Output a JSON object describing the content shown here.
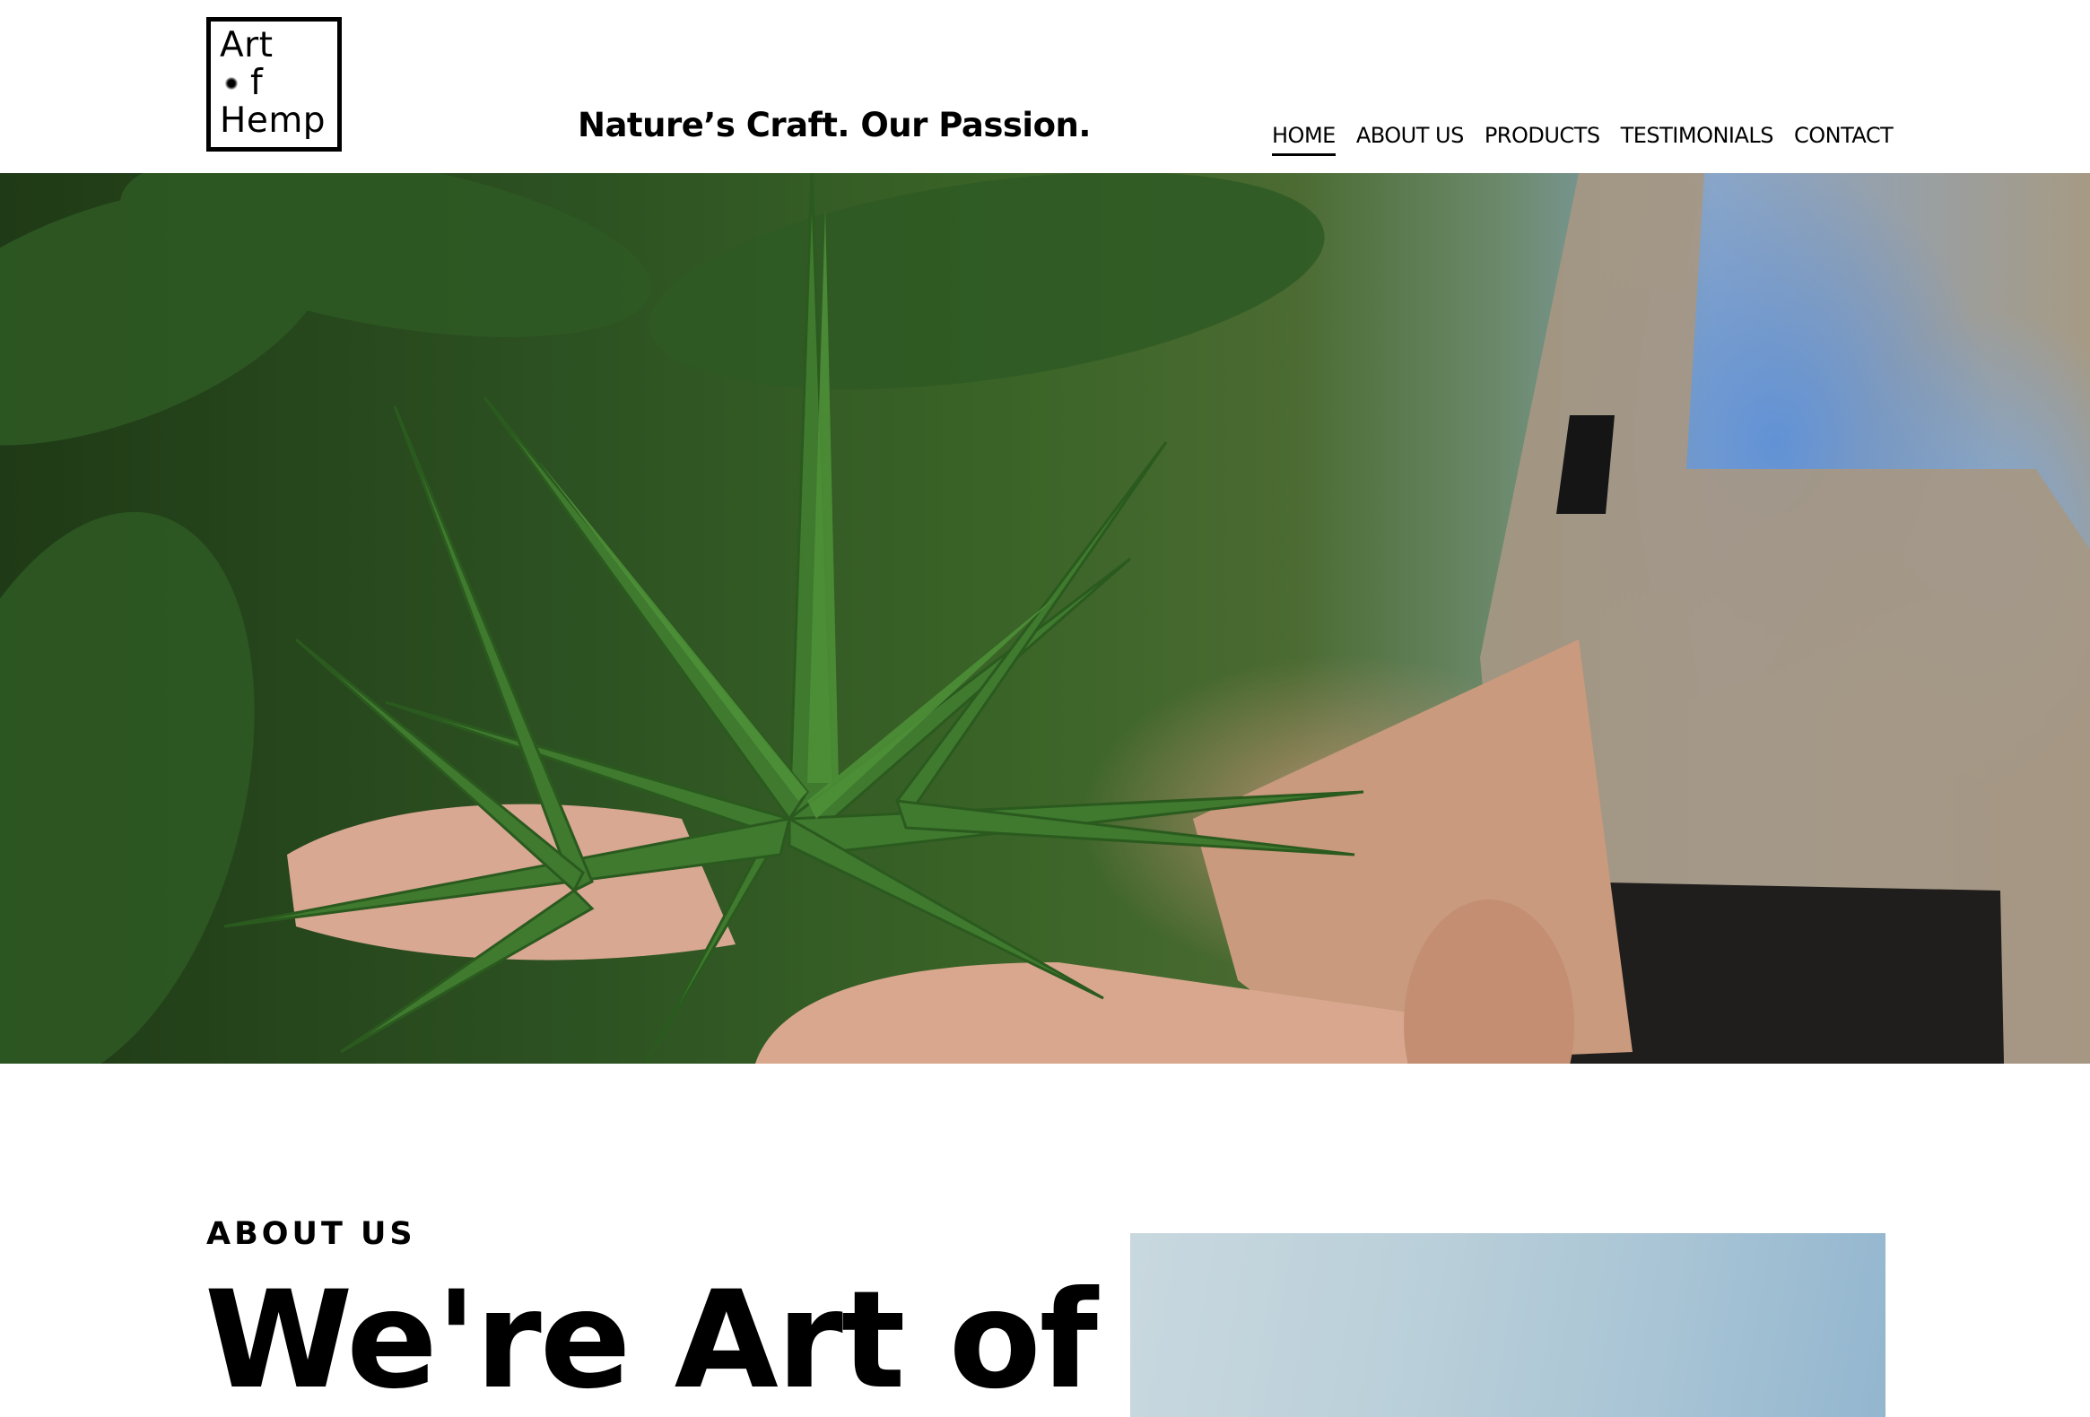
{
  "header": {
    "logo": {
      "line1": "Art",
      "line2_letter": "f",
      "line3": "Hemp"
    },
    "tagline": "Nature’s Craft. Our Passion.",
    "nav": [
      {
        "label": "HOME",
        "active": true
      },
      {
        "label": "ABOUT US",
        "active": false
      },
      {
        "label": "PRODUCTS",
        "active": false
      },
      {
        "label": "TESTIMONIALS",
        "active": false
      },
      {
        "label": "CONTACT",
        "active": false
      }
    ]
  },
  "hero": {
    "image": "farmer-hands-holding-hemp-plant"
  },
  "about": {
    "label": "ABOUT US",
    "heading": "We're Art of",
    "image": "sky-photo"
  },
  "colors": {
    "text": "#000000",
    "background": "#ffffff",
    "leaf_green": "#3f7a2f",
    "shirt_blue": "#5f91d7"
  }
}
